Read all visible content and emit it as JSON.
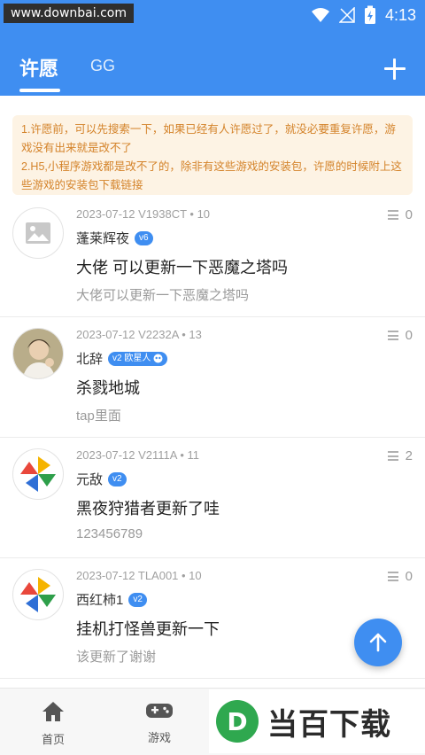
{
  "status_bar": {
    "watermark_url": "www.downbai.com",
    "time": "4:13"
  },
  "tabs": [
    {
      "label": "许愿"
    },
    {
      "label": "GG"
    }
  ],
  "notice": {
    "line1": "1.许愿前，可以先搜索一下，如果已经有人许愿过了，就没必要重复许愿，游戏没有出来就是改不了",
    "line2": "2.H5,小程序游戏都是改不了的，除非有这些游戏的安装包，许愿的时候附上这些游戏的安装包下载链接"
  },
  "posts": [
    {
      "meta": "2023-07-12 V1938CT • 10",
      "name": "蓬莱辉夜",
      "badge": "v6",
      "title": "大佬 可以更新一下恶魔之塔吗",
      "body": "大佬可以更新一下恶魔之塔吗",
      "count": "0",
      "avatar": "image-placeholder-icon"
    },
    {
      "meta": "2023-07-12 V2232A • 13",
      "name": "北辞",
      "badge": "v2 欧星人",
      "title": "杀戮地城",
      "body": "tap里面",
      "count": "0",
      "avatar": "user-photo"
    },
    {
      "meta": "2023-07-12 V2111A • 11",
      "name": "元敌",
      "badge": "v2",
      "title": "黑夜狩猎者更新了哇",
      "body": "123456789",
      "count": "2",
      "avatar": "pinwheel-logo"
    },
    {
      "meta": "2023-07-12 TLA001 • 10",
      "name": "西红柿1",
      "badge": "v2",
      "title": "挂机打怪兽更新一下",
      "body": "该更新了谢谢",
      "count": "0",
      "avatar": "pinwheel-logo"
    }
  ],
  "bottom_nav": [
    {
      "label": "首页",
      "icon": "home-icon"
    },
    {
      "label": "游戏",
      "icon": "gamepad-icon"
    }
  ],
  "brand": {
    "text": "当百下载",
    "letter": "D"
  },
  "colors": {
    "primary": "#3f8ef1",
    "notice_bg": "#fdf3e4",
    "notice_text": "#d4832a"
  }
}
